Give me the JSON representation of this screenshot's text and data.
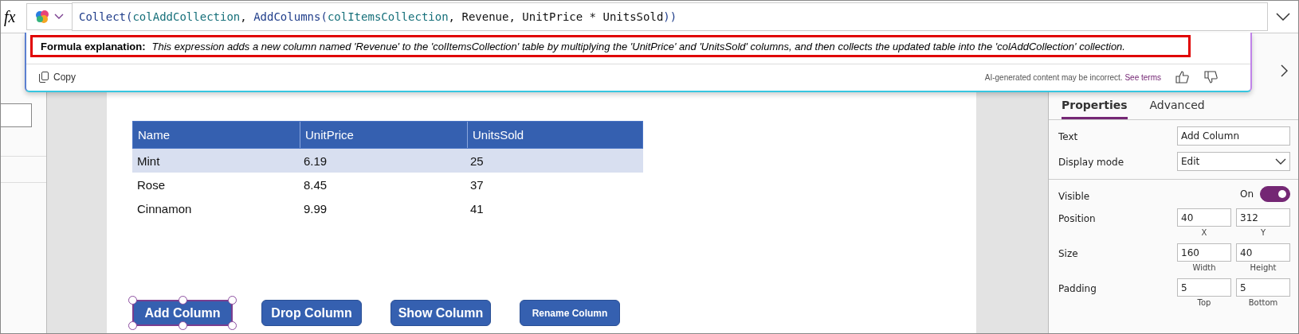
{
  "formula_bar": {
    "fx": "fx",
    "tokens": [
      {
        "kind": "function",
        "text": "Collect("
      },
      {
        "kind": "identifier",
        "text": "colAddCollection"
      },
      {
        "kind": "plain",
        "text": ", "
      },
      {
        "kind": "function",
        "text": "AddColumns("
      },
      {
        "kind": "identifier",
        "text": "colItemsCollection"
      },
      {
        "kind": "plain",
        "text": ", Revenue, UnitPrice * UnitsSold"
      },
      {
        "kind": "function",
        "text": "))"
      }
    ]
  },
  "explanation": {
    "label": "Formula explanation:",
    "text": "This expression adds a new column named 'Revenue' to the 'colItemsCollection' table by multiplying the 'UnitPrice' and 'UnitsSold' columns, and then collects the updated table into the 'colAddCollection' collection.",
    "copy": "Copy",
    "disclaimer": "AI-generated content may be incorrect.",
    "terms_link": "See terms"
  },
  "table": {
    "columns": [
      "Name",
      "UnitPrice",
      "UnitsSold"
    ],
    "rows": [
      {
        "selected": true,
        "cells": [
          "Mint",
          "6.19",
          "25"
        ]
      },
      {
        "selected": false,
        "cells": [
          "Rose",
          "8.45",
          "37"
        ]
      },
      {
        "selected": false,
        "cells": [
          "Cinnamon",
          "9.99",
          "41"
        ]
      }
    ]
  },
  "buttons": [
    {
      "label": "Add Column",
      "selected": true,
      "kind": "regular"
    },
    {
      "label": "Drop Column",
      "selected": false,
      "kind": "regular"
    },
    {
      "label": "Show Column",
      "selected": false,
      "kind": "regular"
    },
    {
      "label": "Rename Column",
      "selected": false,
      "kind": "compact"
    }
  ],
  "properties": {
    "tabs": [
      {
        "label": "Properties",
        "selected": true
      },
      {
        "label": "Advanced",
        "selected": false
      }
    ],
    "rows": [
      {
        "kind": "text",
        "label": "Text",
        "value": "Add Column"
      },
      {
        "kind": "dropdown",
        "label": "Display mode",
        "value": "Edit"
      },
      {
        "kind": "divider"
      },
      {
        "kind": "toggle",
        "label": "Visible",
        "value": "On",
        "on": true
      },
      {
        "kind": "pair",
        "label": "Position",
        "values": [
          "40",
          "312"
        ],
        "captions": [
          "X",
          "Y"
        ]
      },
      {
        "kind": "pair",
        "label": "Size",
        "values": [
          "160",
          "40"
        ],
        "captions": [
          "Width",
          "Height"
        ]
      },
      {
        "kind": "pair",
        "label": "Padding",
        "values": [
          "5",
          "5"
        ],
        "captions": [
          "Top",
          "Bottom"
        ]
      }
    ]
  }
}
